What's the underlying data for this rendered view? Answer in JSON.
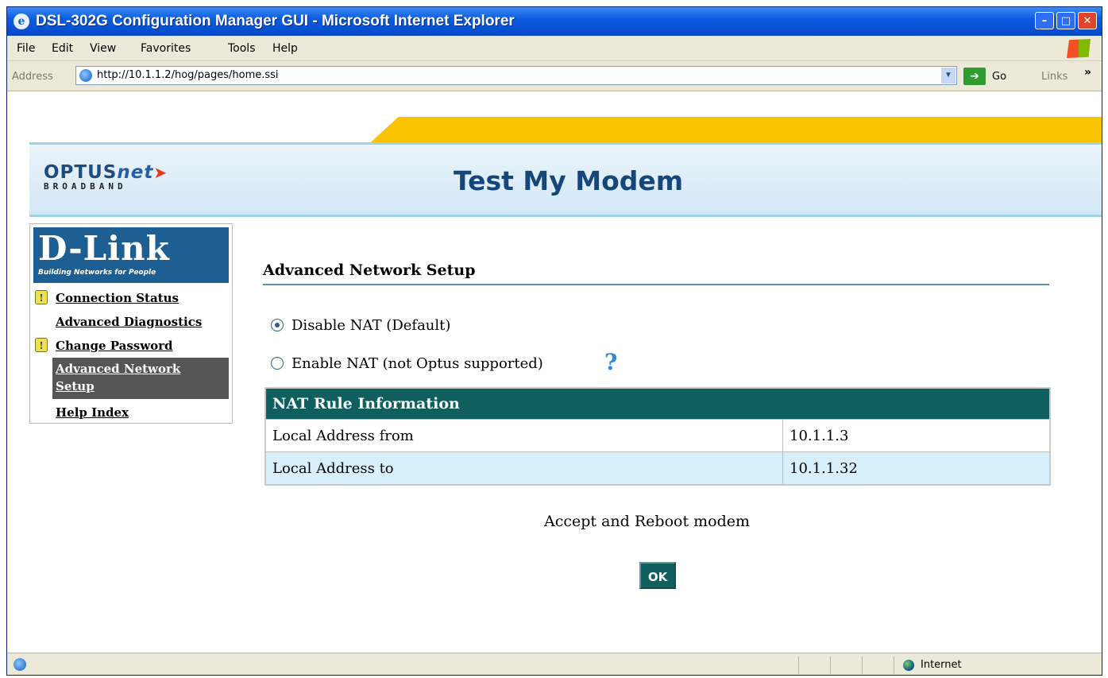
{
  "window": {
    "title": "DSL-302G Configuration Manager GUI - Microsoft Internet Explorer",
    "buttons": {
      "minimize": "–",
      "maximize": "□",
      "close": "✕"
    }
  },
  "menu": [
    "File",
    "Edit",
    "View",
    "Favorites",
    "Tools",
    "Help"
  ],
  "address_bar": {
    "label": "Address",
    "url": "http://10.1.1.2/hog/pages/home.ssi",
    "go_label": "Go",
    "links_label": "Links"
  },
  "banner": {
    "brand_main": "OPTUS",
    "brand_net": "net",
    "brand_sub": "BROADBAND",
    "title": "Test My Modem"
  },
  "sidebar": {
    "logo_name": "D-Link",
    "logo_tagline": "Building Networks for People",
    "items": [
      {
        "label": "Connection Status",
        "warn": true,
        "active": false
      },
      {
        "label": "Advanced Diagnostics",
        "warn": false,
        "active": false
      },
      {
        "label": "Change Password",
        "warn": true,
        "active": false
      },
      {
        "label": "Advanced Network Setup",
        "warn": false,
        "active": true
      },
      {
        "label": "Help Index",
        "warn": false,
        "active": false
      }
    ]
  },
  "main": {
    "heading": "Advanced Network Setup",
    "options": [
      {
        "label": "Disable NAT (Default)",
        "checked": true
      },
      {
        "label": "Enable NAT (not Optus supported)",
        "checked": false
      }
    ],
    "table": {
      "header": "NAT Rule Information",
      "rows": [
        {
          "label": "Local Address from",
          "value": "10.1.1.3"
        },
        {
          "label": "Local Address to",
          "value": "10.1.1.32"
        }
      ]
    },
    "accept_text": "Accept and Reboot modem",
    "ok_label": "OK"
  },
  "statusbar": {
    "zone": "Internet"
  },
  "colors": {
    "titlebar": "#0b5ce0",
    "accent_yellow": "#f9c300",
    "table_header": "#0f5f5f",
    "table_alt_row": "#d8f0fc",
    "dlink_blue": "#1e5f93"
  }
}
